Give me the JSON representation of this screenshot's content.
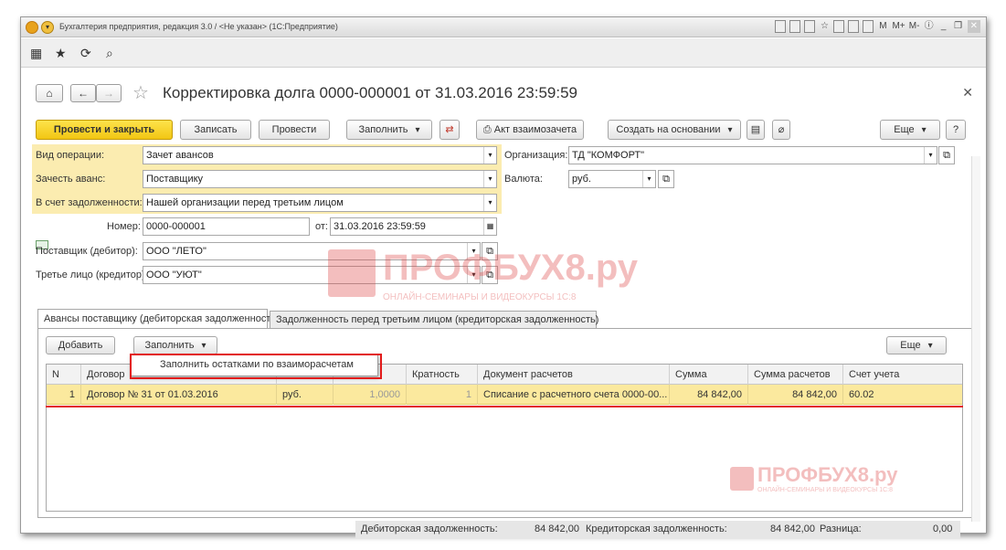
{
  "window": {
    "title": "Бухгалтерия предприятия, редакция 3.0 / <Не указан> (1С:Предприятие)",
    "tb_icons": [
      "M",
      "M+",
      "M-"
    ]
  },
  "document": {
    "title": "Корректировка долга 0000-000001 от 31.03.2016 23:59:59"
  },
  "command_bar": {
    "post_close": "Провести и закрыть",
    "save": "Записать",
    "post": "Провести",
    "fill": "Заполнить",
    "reconciliation": "Акт взаимозачета",
    "create_based": "Создать на основании",
    "more": "Еще",
    "help": "?"
  },
  "form": {
    "operation_label": "Вид операции:",
    "operation_value": "Зачет авансов",
    "offset_label": "Зачесть аванс:",
    "offset_value": "Поставщику",
    "debt_label": "В счет задолженности:",
    "debt_value": "Нашей организации перед третьим лицом",
    "org_label": "Организация:",
    "org_value": "ТД \"КОМФОРТ\"",
    "currency_label": "Валюта:",
    "currency_value": "руб.",
    "number_label": "Номер:",
    "number_value": "0000-000001",
    "date_label": "от:",
    "date_value": "31.03.2016 23:59:59",
    "supplier_label": "Поставщик (дебитор):",
    "supplier_value": "ООО \"ЛЕТО\"",
    "third_label": "Третье лицо (кредитор):",
    "third_value": "ООО \"УЮТ\""
  },
  "tabs": [
    {
      "label": "Авансы поставщику (дебиторская задолженность)"
    },
    {
      "label": "Задолженность перед третьим лицом (кредиторская задолженность)"
    }
  ],
  "table_bar": {
    "add": "Добавить",
    "fill": "Заполнить",
    "more": "Еще"
  },
  "popup": {
    "item": "Заполнить остатками по взаиморасчетам"
  },
  "table": {
    "columns": [
      "N",
      "Договор",
      "",
      "",
      "Кратность",
      "Документ расчетов",
      "Сумма",
      "Сумма расчетов",
      "Счет учета"
    ],
    "row": [
      "1",
      "Договор № 31 от 01.03.2016",
      "руб.",
      "1,0000",
      "1",
      "Списание с расчетного счета 0000-00...",
      "84 842,00",
      "84 842,00",
      "60.02"
    ]
  },
  "footer": {
    "debit_label": "Дебиторская задолженность:",
    "debit_value": "84 842,00",
    "credit_label": "Кредиторская задолженность:",
    "credit_value": "84 842,00",
    "diff_label": "Разница:",
    "diff_value": "0,00"
  },
  "watermark": {
    "text": "ПРОФБУХ8.ру",
    "sub": "ОНЛАЙН-СЕМИНАРЫ И ВИДЕОКУРСЫ 1С:8"
  }
}
